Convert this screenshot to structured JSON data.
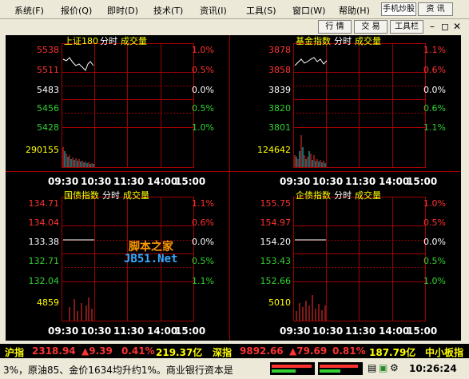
{
  "menu": [
    "系统(F)",
    "报价(Q)",
    "即时(D)",
    "技术(T)",
    "资讯(I)",
    "工具(S)",
    "窗口(W)",
    "帮助(H)"
  ],
  "toolbar": {
    "mobile_label": "手机炒股",
    "news_label": "资 讯",
    "quote_label": "行 情",
    "trade_label": "交 易",
    "tools_label": "工具栏"
  },
  "window_controls": {
    "minimize": "–",
    "restore": "◻",
    "close": "✕"
  },
  "time_ticks": [
    "09:30",
    "10:30",
    "11:30",
    "14:00",
    "15:00"
  ],
  "panels": [
    {
      "title": "上证180",
      "mode": "分时",
      "vol": "成交量",
      "prices": [
        "5538",
        "5511",
        "5483",
        "5456",
        "5428"
      ],
      "pcts": [
        "1.0%",
        "0.5%",
        "0.0%",
        "0.5%",
        "1.0%"
      ],
      "volume": "290155"
    },
    {
      "title": "基金指数",
      "mode": "分时",
      "vol": "成交量",
      "prices": [
        "3878",
        "3858",
        "3839",
        "3820",
        "3801"
      ],
      "pcts": [
        "1.1%",
        "0.6%",
        "0.0%",
        "0.6%",
        "1.1%"
      ],
      "volume": "124642"
    },
    {
      "title": "国债指数",
      "mode": "分时",
      "vol": "成交量",
      "prices": [
        "134.71",
        "134.04",
        "133.38",
        "132.71",
        "132.04"
      ],
      "pcts": [
        "1.1%",
        "0.6%",
        "0.0%",
        "0.5%",
        "1.1%"
      ],
      "volume": "4859"
    },
    {
      "title": "企债指数",
      "mode": "分时",
      "vol": "成交量",
      "prices": [
        "155.75",
        "154.97",
        "154.20",
        "153.43",
        "152.66"
      ],
      "pcts": [
        "1.0%",
        "0.5%",
        "0.0%",
        "0.5%",
        "1.0%"
      ],
      "volume": "5010"
    }
  ],
  "index_bar": {
    "sh_label": "沪指",
    "sh_value": "2318.94",
    "sh_change": "▲9.39",
    "sh_pct": "0.41%",
    "sh_amount": "219.37亿",
    "sz_label": "深指",
    "sz_value": "9892.66",
    "sz_change": "▲79.69",
    "sz_pct": "0.81%",
    "sz_amount": "187.79亿",
    "sme_label": "中小板指"
  },
  "status": {
    "ticker": "3%，原油85、金价1634均升约1%。商业银行资本是",
    "clock": "10:26:24"
  },
  "watermark": {
    "line1": "脚本之家",
    "line2": "JB51.Net"
  },
  "colors": {
    "up": "#ff3232",
    "down": "#32d232",
    "neutral": "#ffffff",
    "grid": "#a00000",
    "title": "#ffff00"
  }
}
